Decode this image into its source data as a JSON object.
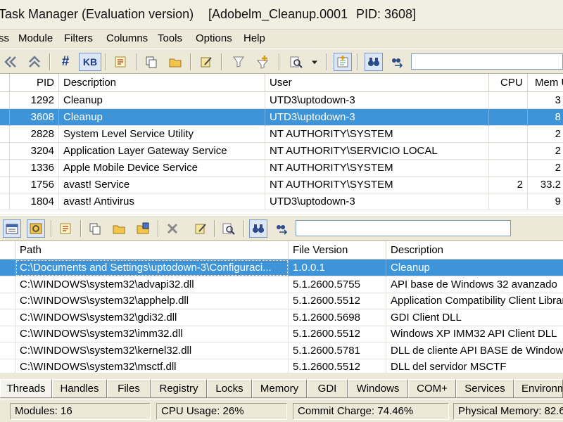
{
  "title": {
    "app": "Task Manager (Evaluation version)",
    "process": "[Adobelm_Cleanup.0001",
    "pid": "PID: 3608]"
  },
  "menu": [
    "ss",
    "Module",
    "Filters",
    "Columns",
    "Tools",
    "Options",
    "Help"
  ],
  "toolbar1": {
    "icons": [
      "back-arrows-icon",
      "forward-arrows-icon",
      "hash-icon",
      "kb-icon",
      "properties-icon",
      "copy-icon",
      "open-folder-icon",
      "edit-icon",
      "filter-icon",
      "add-filter-icon",
      "find-icon",
      "dropdown-arrow-icon",
      "highlight-icon",
      "binoculars-icon",
      "find-next-icon"
    ],
    "hash_label": "#",
    "kb_label": "KB",
    "search_value": ""
  },
  "processes": {
    "columns": [
      "PID",
      "Description",
      "User",
      "CPU",
      "Mem U"
    ],
    "rows": [
      {
        "pid": "1292",
        "description": "Cleanup",
        "user": "UTD3\\uptodown-3",
        "cpu": "",
        "mem": "3"
      },
      {
        "pid": "3608",
        "description": "Cleanup",
        "user": "UTD3\\uptodown-3",
        "cpu": "",
        "mem": "8",
        "selected": true
      },
      {
        "pid": "2828",
        "description": "System Level Service Utility",
        "user": "NT AUTHORITY\\SYSTEM",
        "cpu": "",
        "mem": "2"
      },
      {
        "pid": "3204",
        "description": "Application Layer Gateway Service",
        "user": "NT AUTHORITY\\SERVICIO LOCAL",
        "cpu": "",
        "mem": "2"
      },
      {
        "pid": "1336",
        "description": "Apple Mobile Device Service",
        "user": "NT AUTHORITY\\SYSTEM",
        "cpu": "",
        "mem": "2"
      },
      {
        "pid": "1756",
        "description": "avast! Service",
        "user": "NT AUTHORITY\\SYSTEM",
        "cpu": "2",
        "mem": "33.2"
      },
      {
        "pid": "1804",
        "description": "avast! Antivirus",
        "user": "UTD3\\uptodown-3",
        "cpu": "",
        "mem": "9"
      }
    ]
  },
  "toolbar2": {
    "icons": [
      "modules-view-icon",
      "dll-view-icon",
      "properties-icon",
      "copy-icon",
      "open-folder-icon",
      "save-icon",
      "close-icon",
      "edit-icon",
      "find-icon",
      "binoculars-icon",
      "find-next-icon"
    ],
    "search_value": ""
  },
  "modules": {
    "columns": [
      "Path",
      "File Version",
      "Description"
    ],
    "rows": [
      {
        "path": "C:\\Documents and Settings\\uptodown-3\\Configuraci...",
        "version": "1.0.0.1",
        "description": "Cleanup",
        "selected": true
      },
      {
        "path": "C:\\WINDOWS\\system32\\advapi32.dll",
        "version": "5.1.2600.5755",
        "description": "API base de Windows 32 avanzado"
      },
      {
        "path": "C:\\WINDOWS\\system32\\apphelp.dll",
        "version": "5.1.2600.5512",
        "description": "Application Compatibility Client Librar"
      },
      {
        "path": "C:\\WINDOWS\\system32\\gdi32.dll",
        "version": "5.1.2600.5698",
        "description": "GDI Client DLL"
      },
      {
        "path": "C:\\WINDOWS\\system32\\imm32.dll",
        "version": "5.1.2600.5512",
        "description": "Windows XP IMM32 API Client DLL"
      },
      {
        "path": "C:\\WINDOWS\\system32\\kernel32.dll",
        "version": "5.1.2600.5781",
        "description": "DLL de cliente API BASE de Window..."
      },
      {
        "path": "C:\\WINDOWS\\system32\\msctf.dll",
        "version": "5.1.2600.5512",
        "description": "DLL del servidor MSCTF"
      }
    ]
  },
  "tabs": [
    "Threads",
    "Handles",
    "Files",
    "Registry",
    "Locks",
    "Memory",
    "GDI",
    "Windows",
    "COM+",
    "Services",
    "Environm"
  ],
  "status": {
    "modules": "Modules: 16",
    "cpu": "CPU Usage: 26%",
    "commit": "Commit Charge: 74.46%",
    "physical": "Physical Memory: 82.6"
  },
  "colors": {
    "selection": "#3d94d8",
    "chrome": "#ece9d8"
  }
}
